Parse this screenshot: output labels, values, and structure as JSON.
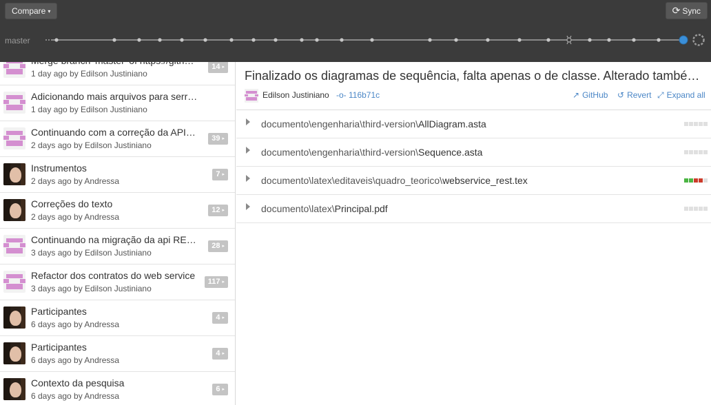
{
  "toolbar": {
    "compare_label": "Compare",
    "compare_caret": "▾",
    "sync_label": "Sync",
    "sync_icon": "sync-icon"
  },
  "branch": {
    "label": "master"
  },
  "commits": [
    {
      "title": "Merge branch 'master' of https://github.com/…",
      "meta": "1 day ago by Edilson Justiniano",
      "count": "14",
      "avatar": "identicon"
    },
    {
      "title": "Adicionando mais arquivos para serrem ignorados",
      "meta": "1 day ago by Edilson Justiniano",
      "count": "",
      "avatar": "identicon"
    },
    {
      "title": "Continuando com a correção da API REST",
      "meta": "2 days ago by Edilson Justiniano",
      "count": "39",
      "avatar": "identicon"
    },
    {
      "title": "Instrumentos",
      "meta": "2 days ago by Andressa",
      "count": "7",
      "avatar": "photo"
    },
    {
      "title": "Correções do texto",
      "meta": "2 days ago by Andressa",
      "count": "12",
      "avatar": "photo"
    },
    {
      "title": "Continuando na migração da api RESTful",
      "meta": "3 days ago by Edilson Justiniano",
      "count": "28",
      "avatar": "identicon"
    },
    {
      "title": "Refactor dos contratos do web service",
      "meta": "3 days ago by Edilson Justiniano",
      "count": "117",
      "avatar": "identicon"
    },
    {
      "title": "Participantes",
      "meta": "6 days ago by Andressa",
      "count": "4",
      "avatar": "photo"
    },
    {
      "title": "Participantes",
      "meta": "6 days ago by Andressa",
      "count": "4",
      "avatar": "photo"
    },
    {
      "title": "Contexto da pesquisa",
      "meta": "6 days ago by Andressa",
      "count": "6",
      "avatar": "photo"
    }
  ],
  "detail": {
    "title": "Finalizado os diagramas de sequência, falta apenas o de classe. Alterado também…",
    "author": "Edilson Justiniano",
    "sha": "116b71c",
    "actions": {
      "github": "GitHub",
      "revert": "Revert",
      "expand_all": "Expand all"
    },
    "files": [
      {
        "dir": "documento\\engenharia\\third-version\\",
        "name": "AllDiagram.asta",
        "stat": [
          "#e0e0e0",
          "#e0e0e0",
          "#e0e0e0",
          "#e0e0e0",
          "#e0e0e0"
        ]
      },
      {
        "dir": "documento\\engenharia\\third-version\\",
        "name": "Sequence.asta",
        "stat": [
          "#e0e0e0",
          "#e0e0e0",
          "#e0e0e0",
          "#e0e0e0",
          "#e0e0e0"
        ]
      },
      {
        "dir": "documento\\latex\\editaveis\\quadro_teorico\\",
        "name": "webservice_rest.tex",
        "stat": [
          "#4bb543",
          "#4bb543",
          "#cc3b2b",
          "#cc3b2b",
          "#e0e0e0"
        ]
      },
      {
        "dir": "documento\\latex\\",
        "name": "Principal.pdf",
        "stat": [
          "#e0e0e0",
          "#e0e0e0",
          "#e0e0e0",
          "#e0e0e0",
          "#e0e0e0"
        ]
      }
    ]
  },
  "colors": {
    "topbar": "#3b3b3b",
    "link": "#4a86c6",
    "badge": "#c4c4c4",
    "timeline_head": "#3a8fd9"
  }
}
